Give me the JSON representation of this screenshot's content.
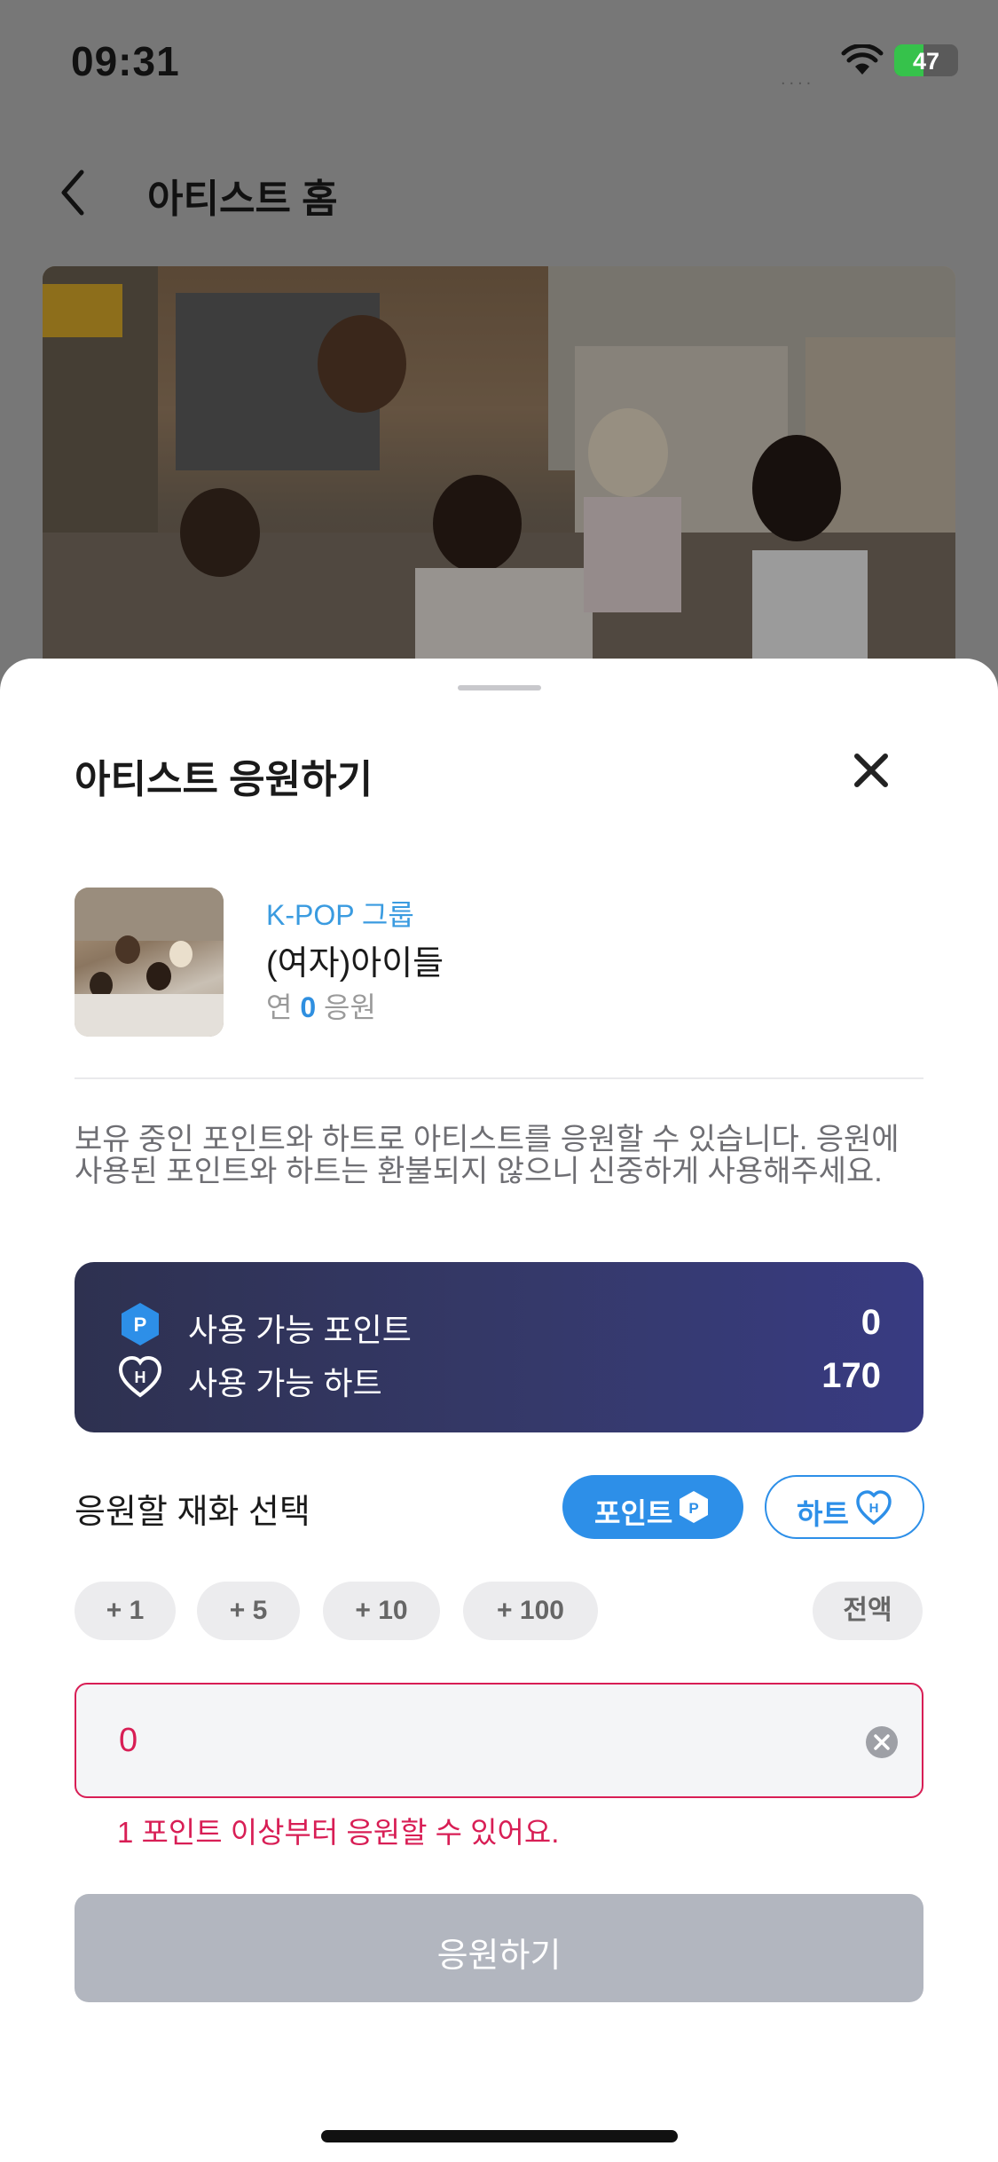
{
  "status_bar": {
    "time": "09:31",
    "signal": "....",
    "battery_text": "47"
  },
  "header": {
    "title": "아티스트 홈"
  },
  "sheet": {
    "title": "아티스트 응원하기",
    "artist": {
      "category": "K-POP 그룹",
      "name": "(여자)아이들",
      "stat_prefix": "연",
      "stat_value": "0",
      "stat_suffix": "응원"
    },
    "description": "보유 중인 포인트와 하트로 아티스트를 응원할 수 있습니다.\n응원에 사용된 포인트와 하트는 환불되지 않으니 신중하게 사용해주세요.",
    "balance": {
      "points_label": "사용 가능 포인트",
      "points_value": "0",
      "hearts_label": "사용 가능 하트",
      "hearts_value": "170",
      "point_icon_letter": "P",
      "heart_icon_letter": "H"
    },
    "currency": {
      "label": "응원할 재화 선택",
      "point_button": "포인트",
      "heart_button": "하트",
      "selected": "포인트"
    },
    "chips": [
      "+ 1",
      "+ 5",
      "+ 10",
      "+ 100"
    ],
    "all_chip": "전액",
    "input": {
      "value": "0"
    },
    "error": "1 포인트 이상부터 응원할 수 있어요.",
    "submit": "응원하기"
  },
  "colors": {
    "accent": "#2d8fe8",
    "error": "#d81e55",
    "card_start": "#2e3150",
    "card_end": "#383b82",
    "disabled": "#b2b6bf"
  },
  "icons": [
    "back-chevron-icon",
    "wifi-icon",
    "battery-icon",
    "close-icon",
    "point-icon",
    "heart-icon",
    "clear-icon"
  ]
}
